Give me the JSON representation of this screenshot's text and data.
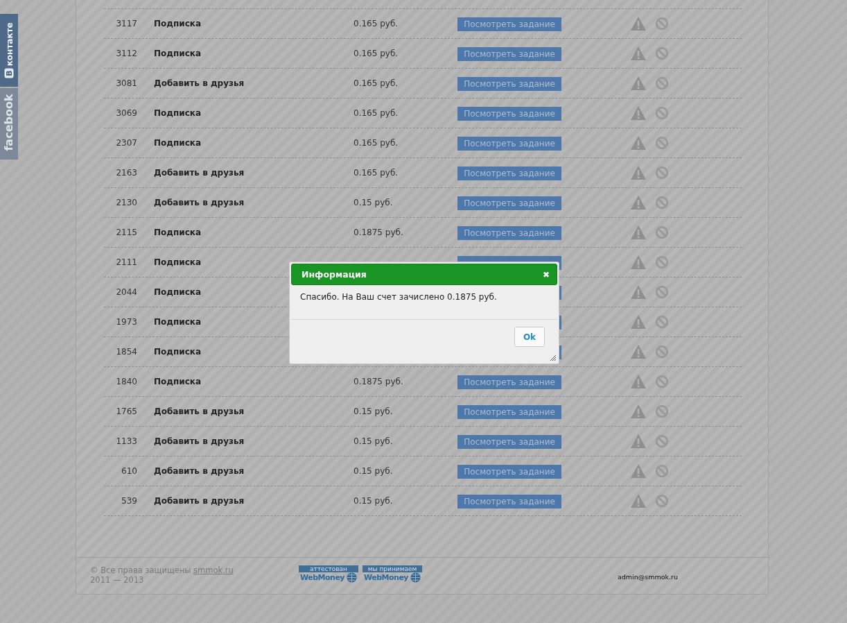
{
  "social": {
    "vk": {
      "logo": "В",
      "label": "контакте"
    },
    "facebook": {
      "label": "facebook"
    }
  },
  "tasks": [
    {
      "id": "3117",
      "type": "Подписка",
      "reward": "0.165 руб.",
      "button": "Посмотреть задание"
    },
    {
      "id": "3112",
      "type": "Подписка",
      "reward": "0.165 руб.",
      "button": "Посмотреть задание"
    },
    {
      "id": "3081",
      "type": "Добавить в друзья",
      "reward": "0.165 руб.",
      "button": "Посмотреть задание"
    },
    {
      "id": "3069",
      "type": "Подписка",
      "reward": "0.165 руб.",
      "button": "Посмотреть задание"
    },
    {
      "id": "2307",
      "type": "Подписка",
      "reward": "0.165 руб.",
      "button": "Посмотреть задание"
    },
    {
      "id": "2163",
      "type": "Добавить в друзья",
      "reward": "0.165 руб.",
      "button": "Посмотреть задание"
    },
    {
      "id": "2130",
      "type": "Добавить в друзья",
      "reward": "0.15 руб.",
      "button": "Посмотреть задание"
    },
    {
      "id": "2115",
      "type": "Подписка",
      "reward": "0.1875 руб.",
      "button": "Посмотреть задание"
    },
    {
      "id": "2111",
      "type": "Подписка"
    },
    {
      "id": "2044",
      "type": "Подписка"
    },
    {
      "id": "1973",
      "type": "Подписка"
    },
    {
      "id": "1854",
      "type": "Подписка"
    },
    {
      "id": "1840",
      "type": "Подписка",
      "reward": "0.1875 руб.",
      "button": "Посмотреть задание"
    },
    {
      "id": "1765",
      "type": "Добавить в друзья",
      "reward": "0.15 руб.",
      "button": "Посмотреть задание"
    },
    {
      "id": "1133",
      "type": "Добавить в друзья",
      "reward": "0.15 руб.",
      "button": "Посмотреть задание"
    },
    {
      "id": "610",
      "type": "Добавить в друзья",
      "reward": "0.15 руб.",
      "button": "Посмотреть задание"
    },
    {
      "id": "539",
      "type": "Добавить в друзья",
      "reward": "0.15 руб.",
      "button": "Посмотреть задание"
    }
  ],
  "footer": {
    "copyright": "© Все права защищены",
    "site_link": "smmok.ru",
    "years": "2011 — 2013",
    "badges": [
      {
        "caption": "аттестован",
        "brand": "WebMoney"
      },
      {
        "caption": "мы принимаем",
        "brand": "WebMoney"
      }
    ],
    "email": "admin@smmok.ru"
  },
  "dialog": {
    "title": "Информация",
    "close": "✖",
    "message": "Спасибо. На Ваш счет зачислено 0.1875 руб.",
    "ok": "Ok"
  }
}
